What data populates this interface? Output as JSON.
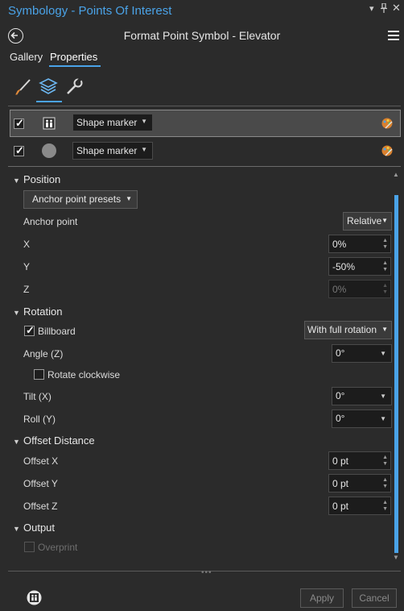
{
  "window": {
    "title": "Symbology - Points Of Interest",
    "pin_icon": "pin-icon",
    "close_icon": "close-icon"
  },
  "header": {
    "title": "Format Point Symbol - Elevator"
  },
  "tabs": [
    {
      "label": "Gallery",
      "active": false
    },
    {
      "label": "Properties",
      "active": true
    }
  ],
  "icon_tabs": [
    "brush-icon",
    "layers-icon",
    "wrench-icon"
  ],
  "layers": [
    {
      "checked": true,
      "icon": "elevator-icon",
      "type": "Shape marker",
      "selected": true
    },
    {
      "checked": true,
      "icon": "circle-icon",
      "type": "Shape marker",
      "selected": false
    }
  ],
  "position": {
    "heading": "Position",
    "presets_button": "Anchor point presets",
    "anchor_label": "Anchor point",
    "anchor_value": "Relative",
    "x_label": "X",
    "x_value": "0%",
    "y_label": "Y",
    "y_value": "-50%",
    "z_label": "Z",
    "z_value": "0%"
  },
  "rotation": {
    "heading": "Rotation",
    "billboard_label": "Billboard",
    "billboard_checked": true,
    "billboard_mode": "With full rotation",
    "angle_label": "Angle (Z)",
    "angle_value": "0°",
    "clockwise_label": "Rotate clockwise",
    "tilt_label": "Tilt (X)",
    "tilt_value": "0°",
    "roll_label": "Roll (Y)",
    "roll_value": "0°"
  },
  "offset": {
    "heading": "Offset Distance",
    "x_label": "Offset X",
    "x_value": "0 pt",
    "y_label": "Offset Y",
    "y_value": "0 pt",
    "z_label": "Offset Z",
    "z_value": "0 pt"
  },
  "output": {
    "heading": "Output",
    "overprint_label": "Overprint"
  },
  "footer": {
    "apply": "Apply",
    "cancel": "Cancel"
  },
  "colors": {
    "accent": "#4aa3e8",
    "background": "#2b2b2b"
  }
}
